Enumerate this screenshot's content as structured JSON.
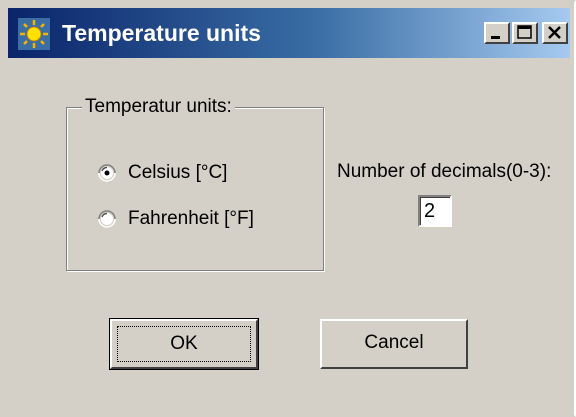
{
  "window": {
    "title": "Temperature units",
    "icon": "sun-icon",
    "controls": [
      "minimize-icon",
      "maximize-icon",
      "close-icon"
    ]
  },
  "units_group": {
    "legend": "Temperatur units:",
    "options": [
      {
        "label": "Celsius [°C]",
        "selected": true
      },
      {
        "label": "Fahrenheit [°F]",
        "selected": false
      }
    ]
  },
  "decimals": {
    "label": "Number of decimals(0-3):",
    "value": "2"
  },
  "buttons": {
    "ok_label": "OK",
    "cancel_label": "Cancel"
  },
  "colors": {
    "titlebar_start": "#0a246a",
    "titlebar_end": "#a6caf0",
    "face": "#d4d0c8"
  }
}
